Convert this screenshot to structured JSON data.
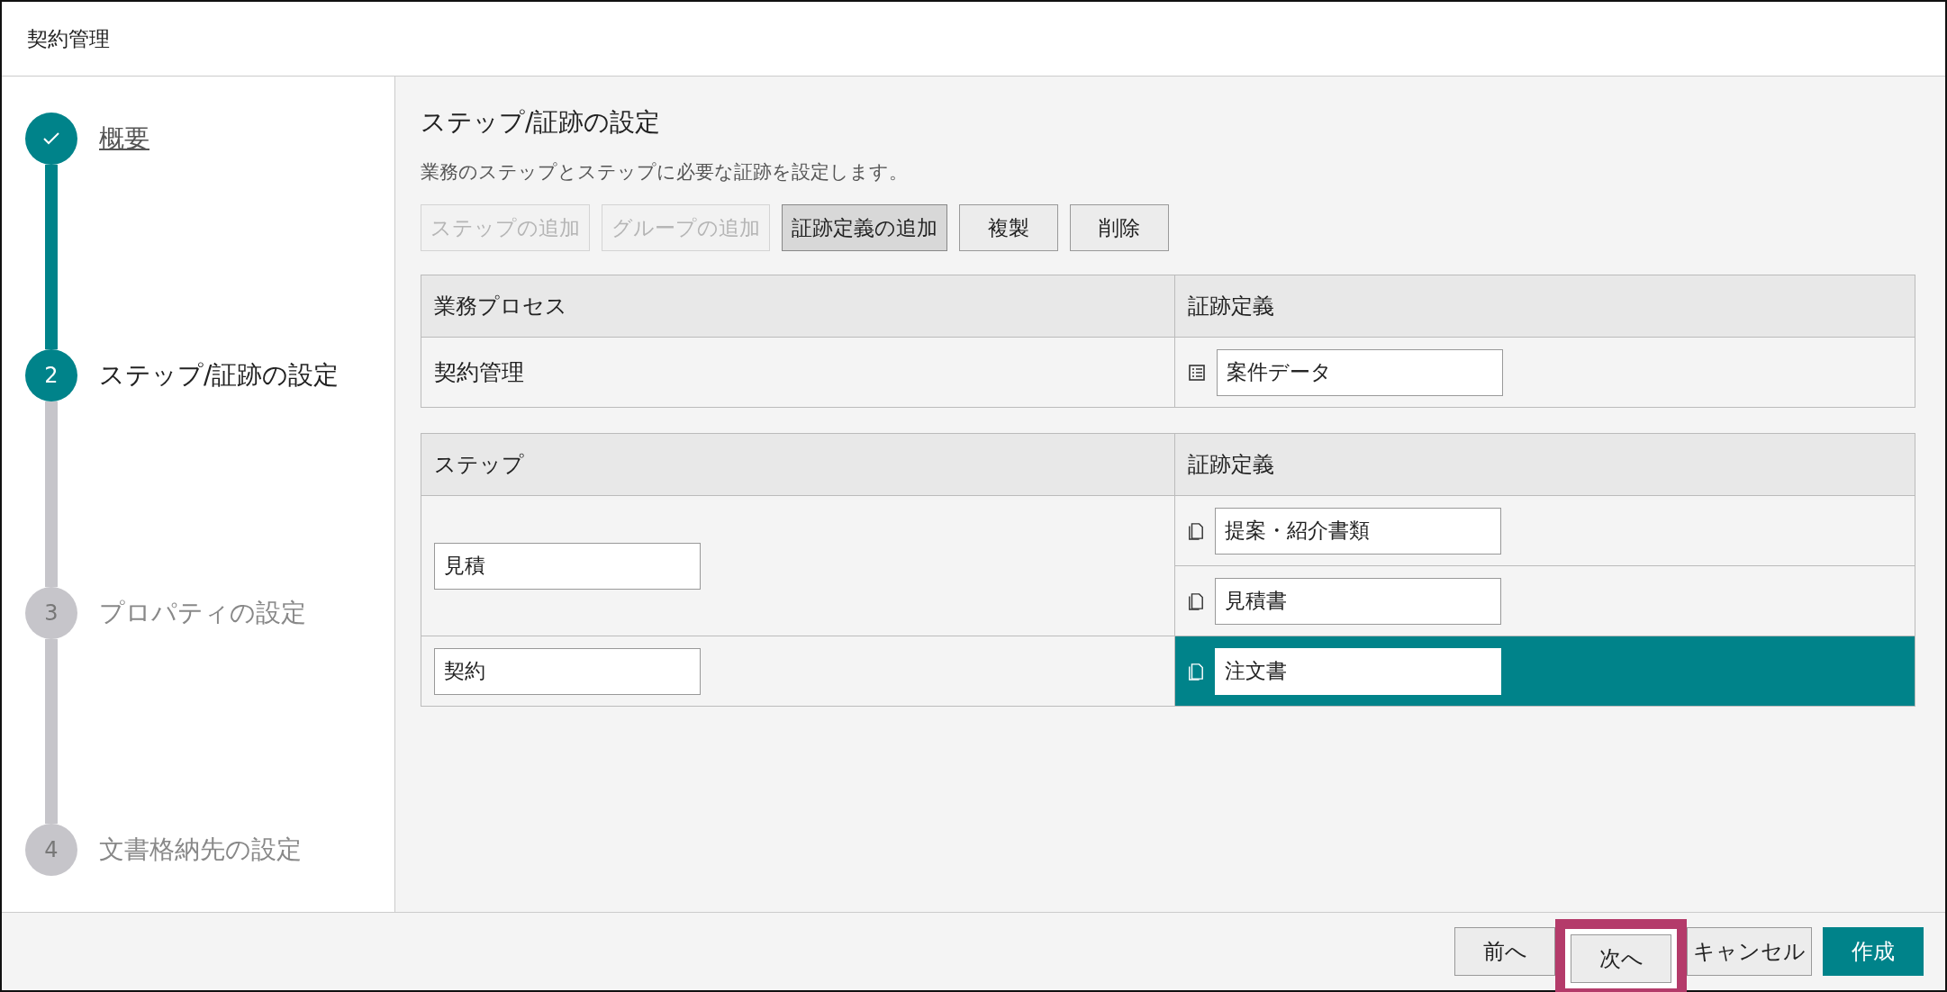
{
  "window": {
    "title": "契約管理"
  },
  "steps": [
    {
      "label": "概要",
      "completed": true,
      "selected": false
    },
    {
      "number": "2",
      "label": "ステップ/証跡の設定",
      "completed": false,
      "selected": true
    },
    {
      "number": "3",
      "label": "プロパティの設定",
      "completed": false,
      "selected": false
    },
    {
      "number": "4",
      "label": "文書格納先の設定",
      "completed": false,
      "selected": false
    }
  ],
  "content": {
    "heading": "ステップ/証跡の設定",
    "description": "業務のステップとステップに必要な証跡を設定します。",
    "toolbar": [
      {
        "label": "ステップの追加",
        "disabled": true,
        "selected": false
      },
      {
        "label": "グループの追加",
        "disabled": true,
        "selected": false
      },
      {
        "label": "証跡定義の追加",
        "disabled": false,
        "selected": true
      },
      {
        "label": "複製",
        "disabled": false,
        "selected": false
      },
      {
        "label": "削除",
        "disabled": false,
        "selected": false
      }
    ],
    "process_table": {
      "columns": [
        "業務プロセス",
        "証跡定義"
      ],
      "rows": [
        {
          "name": "契約管理",
          "evidence": [
            {
              "kind": "list",
              "value": "案件データ",
              "selected": false
            }
          ]
        }
      ]
    },
    "step_table": {
      "columns": [
        "ステップ",
        "証跡定義"
      ],
      "rows": [
        {
          "name": "見積",
          "evidence": [
            {
              "kind": "document",
              "value": "提案・紹介書類",
              "selected": false
            },
            {
              "kind": "document",
              "value": "見積書",
              "selected": false
            }
          ]
        },
        {
          "name": "契約",
          "evidence": [
            {
              "kind": "document",
              "value": "注文書",
              "selected": true
            }
          ]
        }
      ]
    }
  },
  "footer": {
    "buttons": [
      {
        "label": "前へ",
        "kind": "default",
        "highlighted": false
      },
      {
        "label": "次へ",
        "kind": "default",
        "highlighted": true
      },
      {
        "label": "キャンセル",
        "kind": "default",
        "highlighted": false
      },
      {
        "label": "作成",
        "kind": "primary",
        "highlighted": false
      }
    ]
  }
}
